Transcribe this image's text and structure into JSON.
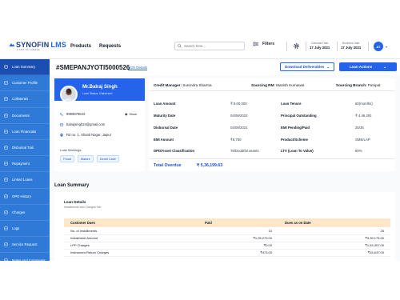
{
  "app": {
    "logo_main": "SYNOFIN",
    "logo_lms": "LMS",
    "logo_sub": "A UNIT OF FINARGE",
    "nav": [
      "Products",
      "Requests"
    ],
    "search_placeholder": "Search here...",
    "filters_label": "Filters",
    "calendar_date_label": "Calendar Date",
    "calendar_date_value": "17 July 2021",
    "business_date_label": "Business Date",
    "business_date_value": "17 July 2021",
    "avatar_initials": "AT"
  },
  "sidebar": {
    "items": [
      {
        "label": "Loan Summary",
        "icon": "document-icon",
        "active": true
      },
      {
        "label": "Customer Profile",
        "icon": "user-icon",
        "active": false
      },
      {
        "label": "Collaterals",
        "icon": "layers-icon",
        "active": false
      },
      {
        "label": "Documents",
        "icon": "file-icon",
        "active": false
      },
      {
        "label": "Loan Financials",
        "icon": "bank-icon",
        "active": false
      },
      {
        "label": "Disbursal Trail",
        "icon": "route-icon",
        "active": false
      },
      {
        "label": "Repayment",
        "icon": "repeat-icon",
        "active": false
      },
      {
        "label": "Linked Loans",
        "icon": "link-icon",
        "active": false
      },
      {
        "label": "OPD History",
        "icon": "history-icon",
        "active": false
      },
      {
        "label": "Charges",
        "icon": "coin-icon",
        "active": false
      },
      {
        "label": "Logs",
        "icon": "log-icon",
        "active": false
      },
      {
        "label": "Service Request",
        "icon": "service-icon",
        "active": false
      },
      {
        "label": "Notes and Comments",
        "icon": "note-icon",
        "active": false
      }
    ]
  },
  "header": {
    "loan_id": "#SMEPANJYOTI5000526",
    "loan_details_link": "LOS Details",
    "download_label": "Download Deliverables",
    "actions_label": "Loan Actions"
  },
  "profile": {
    "name": "Mr.Balraj Singh",
    "status": "Loan Status: Disbursed",
    "phone": "9999878543",
    "show_label": "Show",
    "email": "balrajsingh24@gmail.com",
    "address": "Rd no. 1, Shanti Nagar, Jaipur",
    "markings_label": "Loan Markings:",
    "markings": [
      "Fraud",
      "Mature",
      "Death Case"
    ]
  },
  "details": {
    "credit_manager_label": "Credit Manager:",
    "credit_manager": "Surendra Sharma",
    "sourcing_rm_label": "Sourcing RM:",
    "sourcing_rm": "Manish Kumawat",
    "sourcing_branch_label": "Sourcing Branch:",
    "sourcing_branch": "Panipat",
    "left": [
      {
        "label": "Loan Amount",
        "value": "₹ 5,00,000"
      },
      {
        "label": "Maturity Date",
        "value": "04/09/2023"
      },
      {
        "label": "Disbursal Date",
        "value": "04/09/2021"
      },
      {
        "label": "EMI Amount",
        "value": "₹6,750"
      },
      {
        "label": "DPD/Asset Classification",
        "value": "78/Doubtful assets"
      }
    ],
    "right": [
      {
        "label": "Loan Tenure",
        "value": "60(months)"
      },
      {
        "label": "Principal Outstanding",
        "value": "₹ 4,46,291"
      },
      {
        "label": "EMI Pending/Paid",
        "value": "25/35"
      },
      {
        "label": "Product/Scheme",
        "value": "SME/LAP"
      },
      {
        "label": "LTV (Loan To Value)",
        "value": "60%"
      }
    ],
    "total_overdue_label": "Total Overdue",
    "total_overdue_value": "₹ 5,36,199.63"
  },
  "summary": {
    "title": "Loan Summary",
    "card_title": "Loan Details",
    "card_subtitle": "Installments and Charges Info",
    "columns": [
      "Customer Dues",
      "Paid",
      "Dues as on Date"
    ],
    "rows": [
      {
        "name": "No. of Installments",
        "paid": "10",
        "due": "25"
      },
      {
        "name": "Installment Amount",
        "paid": "₹1,25,270.00",
        "due": "₹3,39,175.00"
      },
      {
        "name": "LPP Charges",
        "paid": "₹0.00",
        "due": "₹1,53,307.00"
      },
      {
        "name": "Instrument Return Charges",
        "paid": "₹473.00",
        "due": "₹15,637.00"
      }
    ]
  }
}
